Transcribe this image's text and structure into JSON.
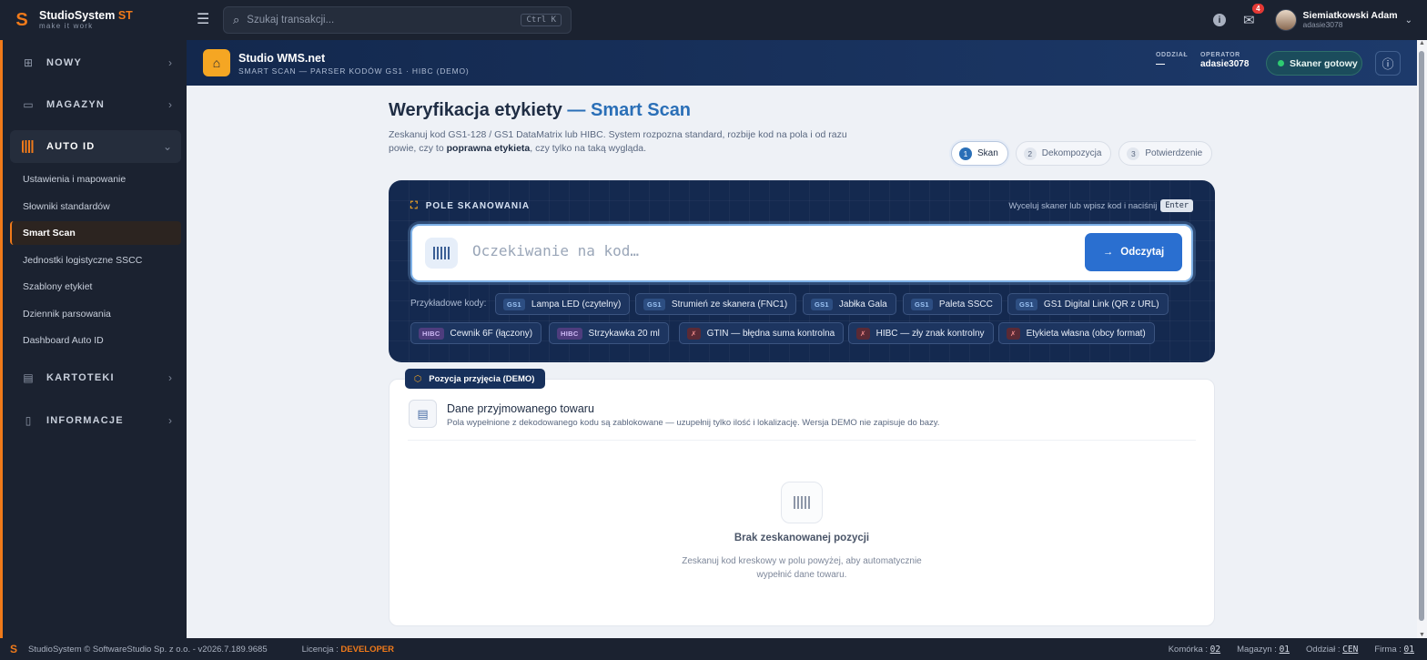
{
  "app": {
    "brand": "StudioSystem",
    "brand_suffix": "ST",
    "tagline": "make it work"
  },
  "topbar": {
    "search_placeholder": "Szukaj transakcji...",
    "search_shortcut": "Ctrl K",
    "mail_count": "4",
    "user_name": "Siemiatkowski Adam",
    "user_login": "adasie3078"
  },
  "sidebar": {
    "sections": [
      {
        "label": "NOWY",
        "icon": "plus-square-icon"
      },
      {
        "label": "MAGAZYN",
        "icon": "warehouse-icon"
      },
      {
        "label": "AUTO ID",
        "icon": "barcode-icon"
      },
      {
        "label": "KARTOTEKI",
        "icon": "card-index-icon"
      },
      {
        "label": "INFORMACJE",
        "icon": "document-icon"
      }
    ],
    "auto_id_items": [
      "Ustawienia i mapowanie",
      "Słowniki standardów",
      "Smart Scan",
      "Jednostki logistyczne SSCC",
      "Szablony etykiet",
      "Dziennik parsowania",
      "Dashboard Auto ID"
    ]
  },
  "header": {
    "title": "Studio WMS.net",
    "subtitle": "SMART SCAN — PARSER KODÓW GS1 · HIBC (DEMO)",
    "branch_label": "ODDZIAŁ",
    "branch_value": "—",
    "operator_label": "OPERATOR",
    "operator_value": "adasie3078",
    "scanner_status": "Skaner gotowy",
    "status_color": "#2ecc71"
  },
  "page": {
    "title": "Weryfikacja etykiety",
    "title_accent": "— Smart Scan",
    "desc_1": "Zeskanuj kod GS1-128 / GS1 DataMatrix lub HIBC. System rozpozna standard, rozbije kod na pola i od razu powie, czy to ",
    "desc_bold": "poprawna etykieta",
    "desc_2": ", czy tylko na taką wygląda.",
    "steps": [
      {
        "num": "1",
        "label": "Skan"
      },
      {
        "num": "2",
        "label": "Dekompozycja"
      },
      {
        "num": "3",
        "label": "Potwierdzenie"
      }
    ]
  },
  "scan": {
    "label": "POLE SKANOWANIA",
    "hint": "Wyceluj skaner lub wpisz kod i naciśnij",
    "hint_key": "Enter",
    "placeholder": "Oczekiwanie na kod…",
    "read_button": "Odczytaj",
    "examples_label": "Przykładowe kody:",
    "examples": [
      {
        "tag": "GS1",
        "label": "Lampa LED (czytelny)"
      },
      {
        "tag": "GS1",
        "label": "Strumień ze skanera (FNC1)"
      },
      {
        "tag": "GS1",
        "label": "Jabłka Gala"
      },
      {
        "tag": "GS1",
        "label": "Paleta SSCC"
      },
      {
        "tag": "GS1",
        "label": "GS1 Digital Link (QR z URL)"
      },
      {
        "tag": "HIBC",
        "label": "Cewnik 6F (łączony)"
      },
      {
        "tag": "HIBC",
        "label": "Strzykawka 20 ml"
      },
      {
        "tag": "✗",
        "label": "GTIN — błędna suma kontrolna"
      },
      {
        "tag": "✗",
        "label": "HIBC — zły znak kontrolny"
      },
      {
        "tag": "✗",
        "label": "Etykieta własna (obcy format)"
      }
    ]
  },
  "position": {
    "badge": "Pozycja przyjęcia (DEMO)",
    "title": "Dane przyjmowanego towaru",
    "desc": "Pola wypełnione z dekodowanego kodu są zablokowane — uzupełnij tylko ilość i lokalizację. Wersja DEMO nie zapisuje do bazy.",
    "empty_title": "Brak zeskanowanej pozycji",
    "empty_desc": "Zeskanuj kod kreskowy w polu powyżej, aby automatycznie wypełnić dane towaru."
  },
  "footer": {
    "copyright": "StudioSystem © SoftwareStudio Sp. z o.o. - v2026.7.189.9685",
    "license_label": "Licencja :",
    "license_value": "DEVELOPER",
    "cell_label": "Komórka :",
    "cell_value": "02",
    "warehouse_label": "Magazyn :",
    "warehouse_value": "01",
    "branch_label": "Oddział :",
    "branch_value": "CEN",
    "company_label": "Firma :",
    "company_value": "01"
  },
  "colors": {
    "accent_orange": "#f07a1a",
    "primary_blue": "#2a6fd0",
    "panel_navy": "#14294f"
  }
}
